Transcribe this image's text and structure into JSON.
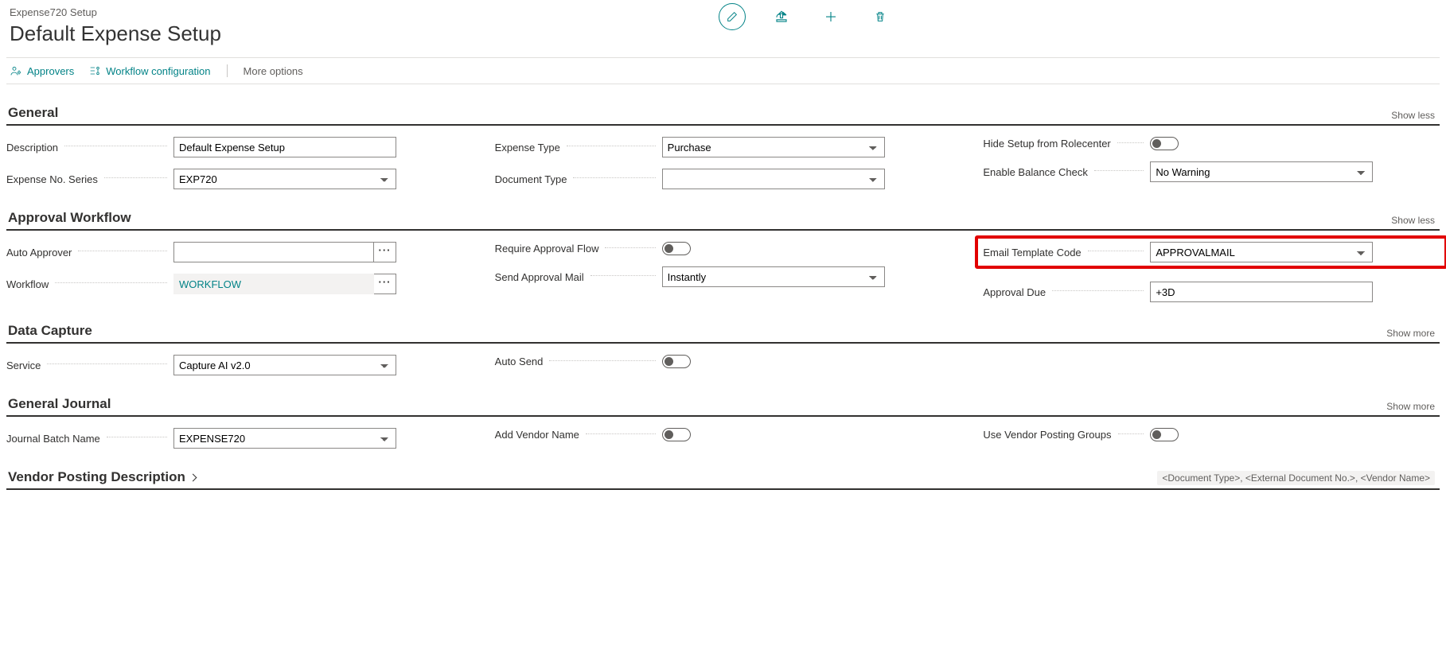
{
  "breadcrumb": "Expense720 Setup",
  "page_title": "Default Expense Setup",
  "action_bar": {
    "approvers": "Approvers",
    "workflow_config": "Workflow configuration",
    "more_options": "More options"
  },
  "show_less": "Show less",
  "show_more": "Show more",
  "sections": {
    "general": {
      "title": "General",
      "description_label": "Description",
      "description_value": "Default Expense Setup",
      "expense_no_label": "Expense No. Series",
      "expense_no_value": "EXP720",
      "expense_type_label": "Expense Type",
      "expense_type_value": "Purchase",
      "document_type_label": "Document Type",
      "document_type_value": "",
      "hide_setup_label": "Hide Setup from Rolecenter",
      "enable_balance_label": "Enable Balance Check",
      "enable_balance_value": "No Warning"
    },
    "approval": {
      "title": "Approval Workflow",
      "auto_approver_label": "Auto Approver",
      "auto_approver_value": "",
      "workflow_label": "Workflow",
      "workflow_value": "WORKFLOW",
      "require_flow_label": "Require Approval Flow",
      "send_mail_label": "Send Approval Mail",
      "send_mail_value": "Instantly",
      "email_tpl_label": "Email Template Code",
      "email_tpl_value": "APPROVALMAIL",
      "approval_due_label": "Approval Due",
      "approval_due_value": "+3D"
    },
    "data_capture": {
      "title": "Data Capture",
      "service_label": "Service",
      "service_value": "Capture AI v2.0",
      "auto_send_label": "Auto Send"
    },
    "gj": {
      "title": "General Journal",
      "jbn_label": "Journal Batch Name",
      "jbn_value": "EXPENSE720",
      "add_vendor_label": "Add Vendor Name",
      "use_vpg_label": "Use Vendor Posting Groups"
    },
    "vendor_posting": {
      "title": "Vendor Posting Description",
      "summary": "<Document Type>, <External Document No.>, <Vendor Name>"
    }
  }
}
